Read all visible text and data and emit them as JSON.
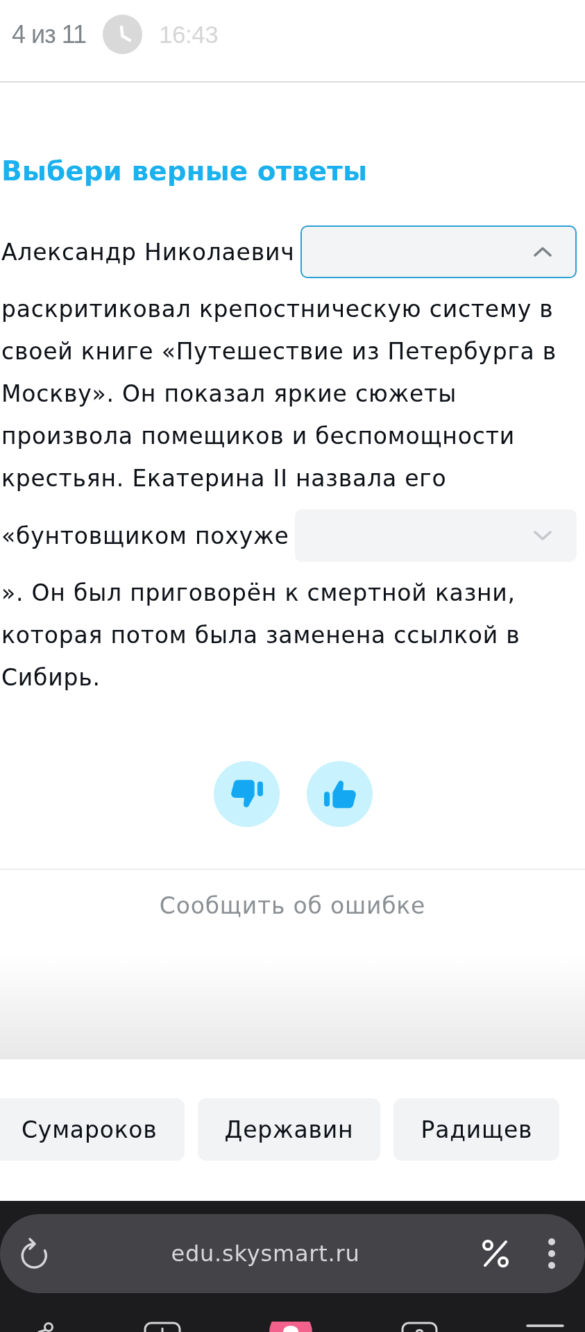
{
  "header": {
    "progress": "4 из 11",
    "time": "16:43"
  },
  "task": {
    "title": "Выбери верные ответы",
    "parts": [
      {
        "kind": "text",
        "text": "Александр Николаевич"
      },
      {
        "kind": "dropdown",
        "expanded": true
      },
      {
        "kind": "text",
        "text": "раскритиковал крепостническую систему в своей книге «Путешествие из Петербурга в Москву». Он показал яркие сюжеты произвола помещиков и беспомощности крестьян. Екатерина II назвала его"
      },
      {
        "kind": "text",
        "text": "«бунтовщиком похуже"
      },
      {
        "kind": "dropdown",
        "expanded": false
      },
      {
        "kind": "text",
        "text": "». Он был приговорён к смертной казни, которая потом была заменена ссылкой в Сибирь."
      }
    ]
  },
  "report_link": "Сообщить об ошибке",
  "answer_options": [
    "Сумароков",
    "Державин",
    "Радищев"
  ],
  "browser": {
    "url": "edu.skysmart.ru"
  }
}
